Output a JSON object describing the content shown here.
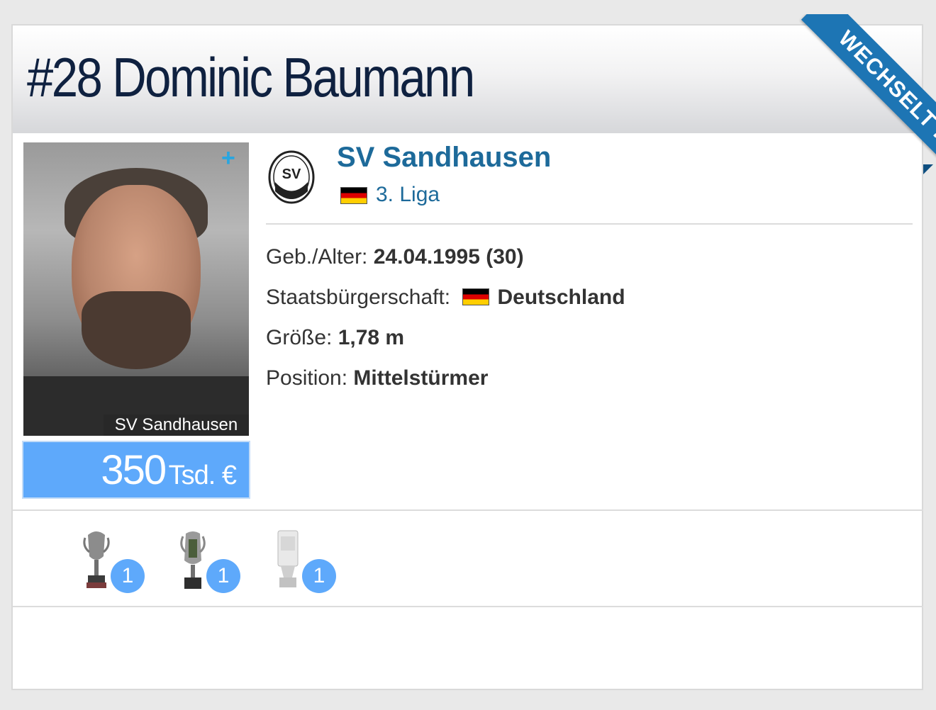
{
  "header": {
    "title": "#28 Dominic Baumann",
    "ribbon_label": "WECHSELT ..."
  },
  "photo": {
    "caption": "SV Sandhausen",
    "plus_icon": "plus-icon"
  },
  "market_value": {
    "amount": "350",
    "unit": "Tsd. €"
  },
  "club": {
    "name": "SV Sandhausen",
    "crest_text": "SV",
    "league": "3. Liga",
    "league_flag": "germany-flag"
  },
  "details": {
    "birth_label": "Geb./Alter:",
    "birth_value": "24.04.1995 (30)",
    "citizenship_label": "Staatsbürgerschaft:",
    "citizenship_value": "Deutschland",
    "height_label": "Größe:",
    "height_value": "1,78 m",
    "position_label": "Position:",
    "position_value": "Mittelstürmer"
  },
  "trophies": [
    {
      "icon": "trophy-icon",
      "count": "1"
    },
    {
      "icon": "cup-icon",
      "count": "1"
    },
    {
      "icon": "silver-cup-icon",
      "count": "1"
    }
  ],
  "colors": {
    "title": "#0f2140",
    "link": "#1d6a9a",
    "ribbon": "#1d75b4",
    "market_bg": "#5ea9fb"
  }
}
